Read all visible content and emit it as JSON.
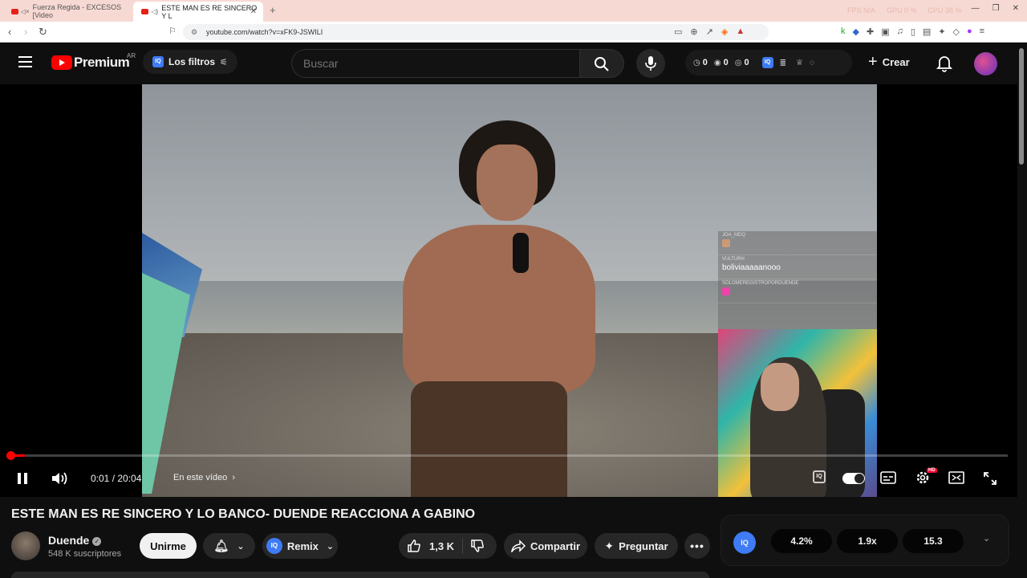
{
  "browser": {
    "tabs": [
      {
        "label": "Fuerza Regida - EXCESOS [Video",
        "active": false
      },
      {
        "label": "ESTE MAN ES RE SINCERO Y L",
        "active": true
      }
    ],
    "new_tab": "+",
    "stats": {
      "fps": "FPS N/A",
      "gpu": "GPU 0 %",
      "cpu": "CPU 38 %"
    },
    "url": "youtube.com/watch?v=xFK9-JSWILI"
  },
  "header": {
    "logo_word": "Premium",
    "country": "AR",
    "filters_label": "Los filtros",
    "iq": "IQ",
    "search_placeholder": "Buscar",
    "counters": [
      "0",
      "0",
      "0"
    ],
    "create_label": "Crear"
  },
  "player": {
    "progress_fraction": 0.0008,
    "time": "0:01 / 20:04",
    "chapter": "En este vídeo",
    "hd": "HD",
    "chat": [
      {
        "user": "JOA_MDQ",
        "msg": ""
      },
      {
        "user": "VULTURH",
        "msg": "boliviaaaaanooo"
      },
      {
        "user": "SOLOMEREGISTROPORDUENDE",
        "msg": ""
      }
    ]
  },
  "video": {
    "title": "ESTE MAN ES RE SINCERO Y LO BANCO- DUENDE REACCIONA A GABINO",
    "channel": "Duende",
    "subscribers": "548 K suscriptores",
    "join_label": "Unirme",
    "remix_label": "Remix",
    "likes": "1,3 K",
    "share_label": "Compartir",
    "ask_label": "Preguntar"
  },
  "stats_panel": {
    "iq": "IQ",
    "values": [
      "4.2%",
      "1.9x",
      "15.3"
    ]
  },
  "colors": {
    "accent": "#ff0000",
    "iq_blue": "#3e7bf5",
    "background": "#0f0f0f"
  }
}
